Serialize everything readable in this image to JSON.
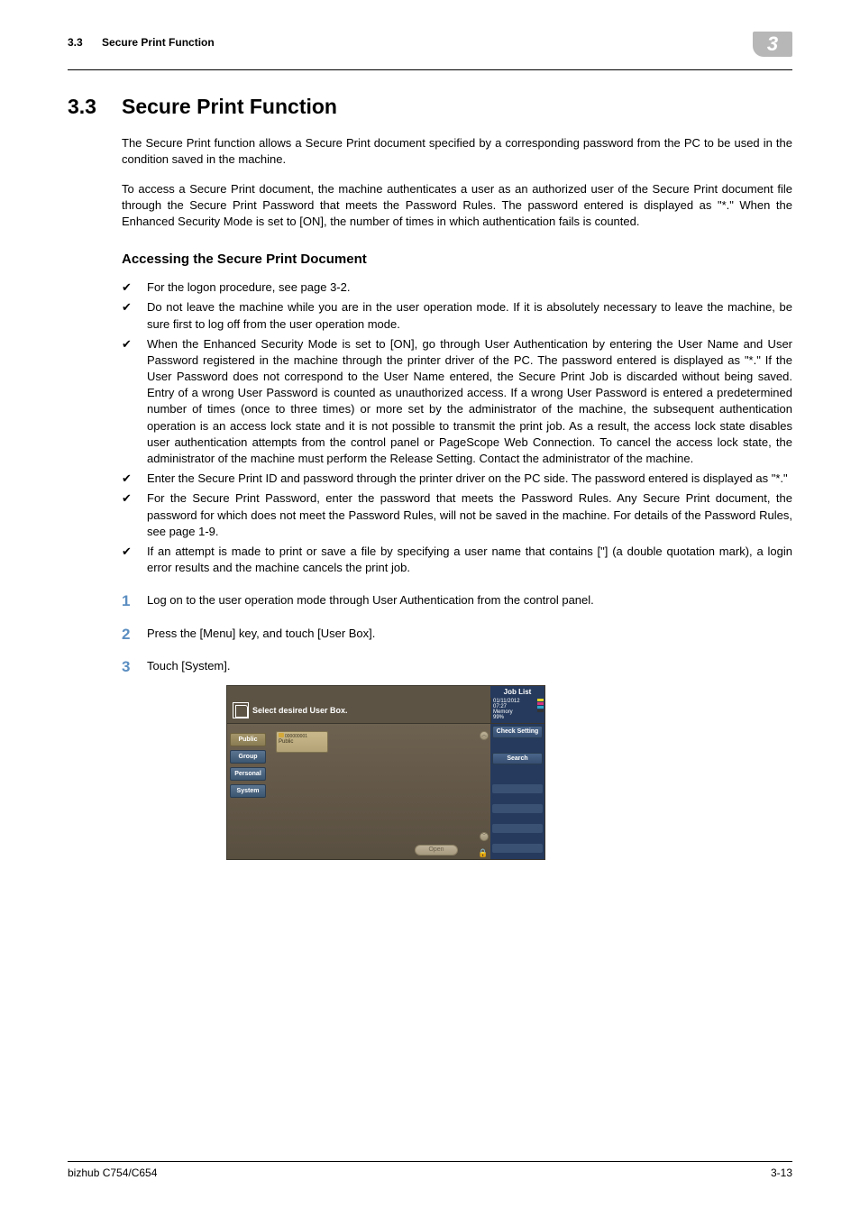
{
  "header": {
    "section_number": "3.3",
    "section_title_short": "Secure Print Function",
    "chapter_tab": "3"
  },
  "title": {
    "number": "3.3",
    "text": "Secure Print Function"
  },
  "paragraphs": {
    "p1": "The Secure Print function allows a Secure Print document specified by a corresponding password from the PC to be used in the condition saved in the machine.",
    "p2": "To access a Secure Print document, the machine authenticates a user as an authorized user of the Secure Print document file through the Secure Print Password that meets the Password Rules. The password entered is displayed as \"*.\" When the Enhanced Security Mode is set to [ON], the number of times in which authentication fails is counted."
  },
  "subheading": "Accessing the Secure Print Document",
  "checks": {
    "c1": "For the logon procedure, see page 3-2.",
    "c2": "Do not leave the machine while you are in the user operation mode. If it is absolutely necessary to leave the machine, be sure first to log off from the user operation mode.",
    "c3": "When the Enhanced Security Mode is set to [ON], go through User Authentication by entering the User Name and User Password registered in the machine through the printer driver of the PC. The password entered is displayed as \"*.\" If the User Password does not correspond to the User Name entered, the Secure Print Job is discarded without being saved. Entry of a wrong User Password is counted as unauthorized access. If a wrong User Password is entered a predetermined number of times (once to three times) or more set by the administrator of the machine, the subsequent authentication operation is an access lock state and it is not possible to transmit the print job. As a result, the access lock state disables user authentication attempts from the control panel or PageScope Web Connection. To cancel the access lock state, the administrator of the machine must perform the Release Setting. Contact the administrator of the machine.",
    "c4": "Enter the Secure Print ID and password through the printer driver on the PC side. The password entered is displayed as \"*.\"",
    "c5": "For the Secure Print Password, enter the password that meets the Password Rules. Any Secure Print document, the password for which does not meet the Password Rules, will not be saved in the machine. For details of the Password Rules, see page 1-9.",
    "c6": "If an attempt is made to print or save a file by specifying a user name that contains [\"] (a double quotation mark), a login error results and the machine cancels the print job."
  },
  "steps": {
    "s1": "Log on to the user operation mode through User Authentication from the control panel.",
    "s2": "Press the [Menu] key, and touch [User Box].",
    "s3": "Touch [System]."
  },
  "step_nums": {
    "n1": "1",
    "n2": "2",
    "n3": "3"
  },
  "device": {
    "job_list": "Job List",
    "prompt": "Select desired User Box.",
    "status_date": "01/11/2012",
    "status_time": "07:27",
    "status_memory": "Memory",
    "status_pct": "99%",
    "toner_y": "Y",
    "toner_m": "M",
    "toner_c": "C",
    "toner_k": "K",
    "tab_public": "Public",
    "tab_group": "Group",
    "tab_personal": "Personal",
    "tab_system": "System",
    "box_num": "000000001",
    "box_label": "Public",
    "open": "Open",
    "check_setting": "Check Setting",
    "search": "Search"
  },
  "footer": {
    "left": "bizhub C754/C654",
    "right": "3-13"
  }
}
